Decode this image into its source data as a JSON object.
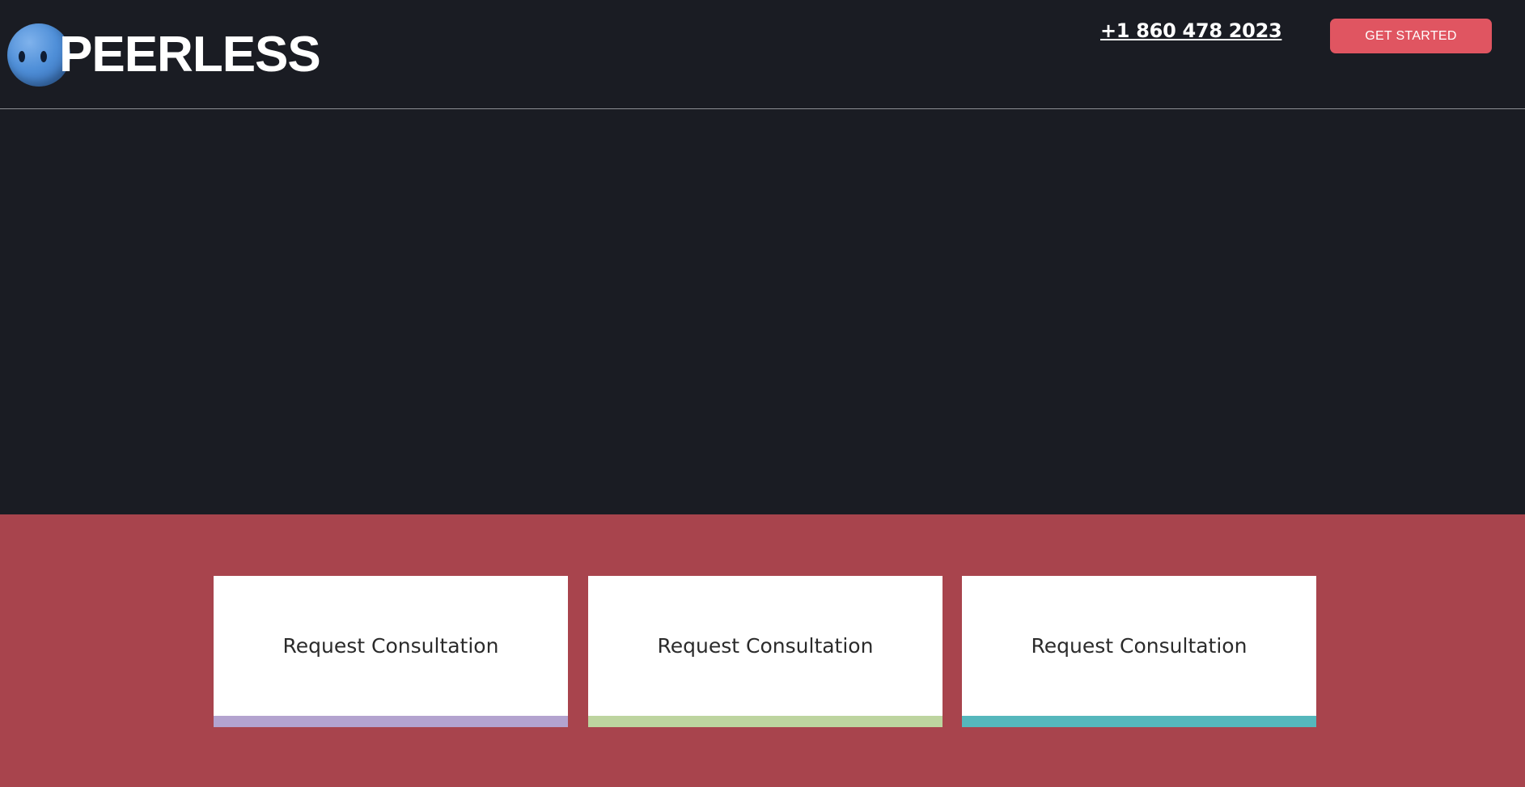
{
  "header": {
    "brand": "PEERLESS",
    "phone": "+1 860 478 2023",
    "cta_label": "GET STARTED"
  },
  "colors": {
    "background": "#1a1c23",
    "band": "#a8444d",
    "cta": "#e05561",
    "card_bar_1": "#b3a3cf",
    "card_bar_2": "#bdd49f",
    "card_bar_3": "#55b7bc"
  },
  "cards": [
    {
      "label": "Request Consultation"
    },
    {
      "label": "Request Consultation"
    },
    {
      "label": "Request Consultation"
    }
  ]
}
